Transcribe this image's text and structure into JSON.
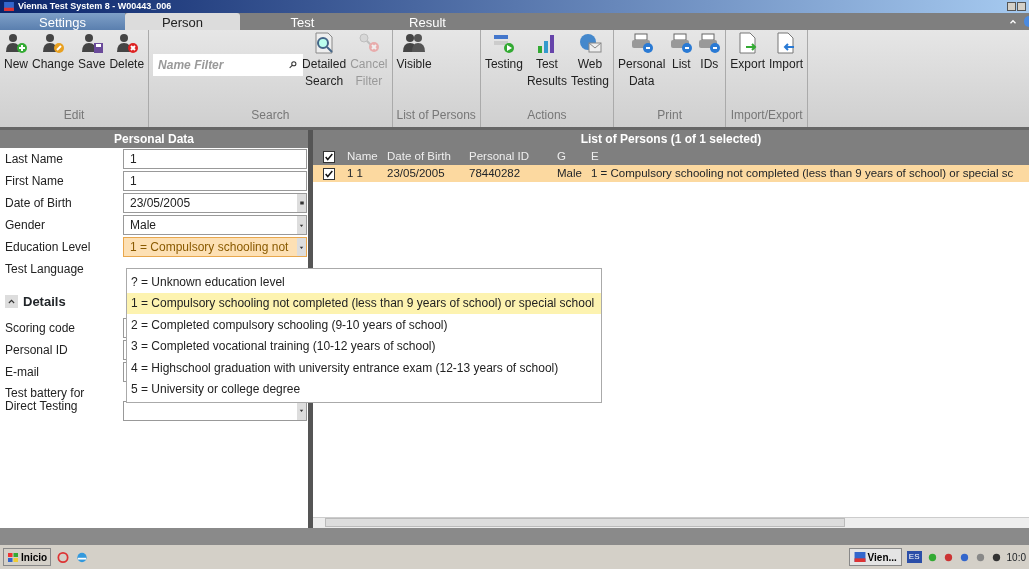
{
  "window": {
    "title": "Vienna Test System 8 - W00443_006"
  },
  "tabs": [
    {
      "label": "Settings",
      "kind": "app",
      "selected": false
    },
    {
      "label": "Person",
      "kind": "page",
      "selected": true
    },
    {
      "label": "Test",
      "kind": "page",
      "selected": false
    },
    {
      "label": "Result",
      "kind": "page",
      "selected": false
    }
  ],
  "ribbon": {
    "groups": [
      {
        "label": "Edit",
        "items": [
          {
            "kind": "person-add",
            "label": "New",
            "disabled": false
          },
          {
            "kind": "person-edit",
            "label": "Change",
            "disabled": false
          },
          {
            "kind": "person-save",
            "label": "Save",
            "disabled": false
          },
          {
            "kind": "person-delete",
            "label": "Delete",
            "disabled": false
          }
        ]
      },
      {
        "label": "Search",
        "items": [
          {
            "kind": "filter-field",
            "placeholder": "Name Filter"
          },
          {
            "kind": "search-doc",
            "label": "Detailed Search",
            "disabled": false
          },
          {
            "kind": "filter-cancel",
            "label": "Cancel Filter",
            "disabled": true
          }
        ]
      },
      {
        "label": "List of Persons",
        "items": [
          {
            "kind": "people",
            "label": "Visible",
            "disabled": false
          }
        ]
      },
      {
        "label": "Actions",
        "items": [
          {
            "kind": "testing",
            "label": "Testing",
            "disabled": false
          },
          {
            "kind": "chart",
            "label": "Test Results",
            "disabled": false
          },
          {
            "kind": "web",
            "label": "Web Testing",
            "disabled": false
          }
        ]
      },
      {
        "label": "Print",
        "items": [
          {
            "kind": "printer",
            "label": "Personal Data",
            "disabled": false
          },
          {
            "kind": "printer",
            "label": "List",
            "disabled": false
          },
          {
            "kind": "printer",
            "label": "IDs",
            "disabled": false
          }
        ]
      },
      {
        "label": "Import/Export",
        "items": [
          {
            "kind": "export",
            "label": "Export",
            "disabled": false
          },
          {
            "kind": "import",
            "label": "Import",
            "disabled": false
          }
        ]
      }
    ]
  },
  "personal_data": {
    "title": "Personal Data",
    "fields": [
      {
        "label": "Last Name",
        "kind": "text",
        "value": "1"
      },
      {
        "label": "First Name",
        "kind": "text",
        "value": "1"
      },
      {
        "label": "Date of Birth",
        "kind": "date",
        "value": "23/05/2005"
      },
      {
        "label": "Gender",
        "kind": "select",
        "value": "Male"
      },
      {
        "label": "Education Level",
        "kind": "select",
        "value": "1 = Compulsory schooling not",
        "open": true
      },
      {
        "label": "Test Language"
      }
    ],
    "details": {
      "label": "Details",
      "expanded": true,
      "fields": [
        {
          "label": "Scoring code",
          "kind": "text"
        },
        {
          "label": "Personal ID",
          "kind": "text"
        },
        {
          "label": "E-mail",
          "kind": "text"
        },
        {
          "label": "Test battery for Direct Testing",
          "kind": "select"
        }
      ]
    },
    "dropdown": {
      "options": [
        {
          "label": "? = Unknown education level",
          "selected": false
        },
        {
          "label": "1 = Compulsory schooling not completed (less than 9 years of school) or special school",
          "selected": true
        },
        {
          "label": "2 = Completed compulsory schooling (9-10 years of school)",
          "selected": false
        },
        {
          "label": "3 = Completed vocational training (10-12 years of school)",
          "selected": false
        },
        {
          "label": "4 = Highschool graduation with university entrance exam (12-13 years of school)",
          "selected": false
        },
        {
          "label": "5 = University or college degree",
          "selected": false
        }
      ]
    }
  },
  "list_of_persons": {
    "title": "List of Persons (1 of 1 selected)",
    "all_checked": true,
    "columns": [
      "Name",
      "Date of Birth",
      "Personal ID",
      "G",
      "E"
    ],
    "rows": [
      {
        "checked": true,
        "selected": true,
        "cells": [
          "1 1",
          "23/05/2005",
          "78440282",
          "Male",
          "1 = Compulsory schooling not completed (less than 9 years of school) or special sc"
        ]
      }
    ]
  },
  "taskbar": {
    "start": "Inicio",
    "tasks": [
      "Vien..."
    ],
    "language": "ES",
    "clock": "10:0"
  }
}
